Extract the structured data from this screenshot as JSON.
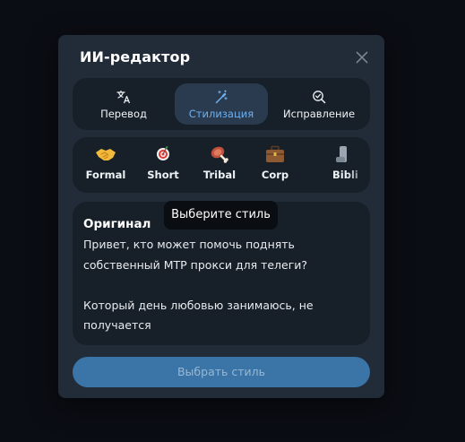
{
  "dialog": {
    "title": "ИИ-редактор",
    "close_icon": "close-icon"
  },
  "tabs": [
    {
      "label": "Перевод",
      "icon": "translate-icon",
      "active": false
    },
    {
      "label": "Стилизация",
      "icon": "magic-wand-icon",
      "active": true
    },
    {
      "label": "Исправление",
      "icon": "spellcheck-icon",
      "active": false
    }
  ],
  "styles": [
    {
      "label": "Formal",
      "icon": "handshake-icon"
    },
    {
      "label": "Short",
      "icon": "target-icon"
    },
    {
      "label": "Tribal",
      "icon": "meat-icon"
    },
    {
      "label": "Corp",
      "icon": "briefcase-icon"
    },
    {
      "label": "Bibli",
      "icon": "scroll-icon"
    }
  ],
  "tooltip": "Выберите стиль",
  "original": {
    "header": "Оригинал",
    "text": "Привет, кто может помочь поднять собственный MTP прокси для телеги?\n\nКоторый день любовью занимаюсь, не получается"
  },
  "button": {
    "label": "Выбрать стиль"
  },
  "colors": {
    "background": "#0b0d14",
    "dialog": "#222c39",
    "panel": "#172029",
    "accent": "#6cb1f2",
    "button": "#3b74a6"
  }
}
